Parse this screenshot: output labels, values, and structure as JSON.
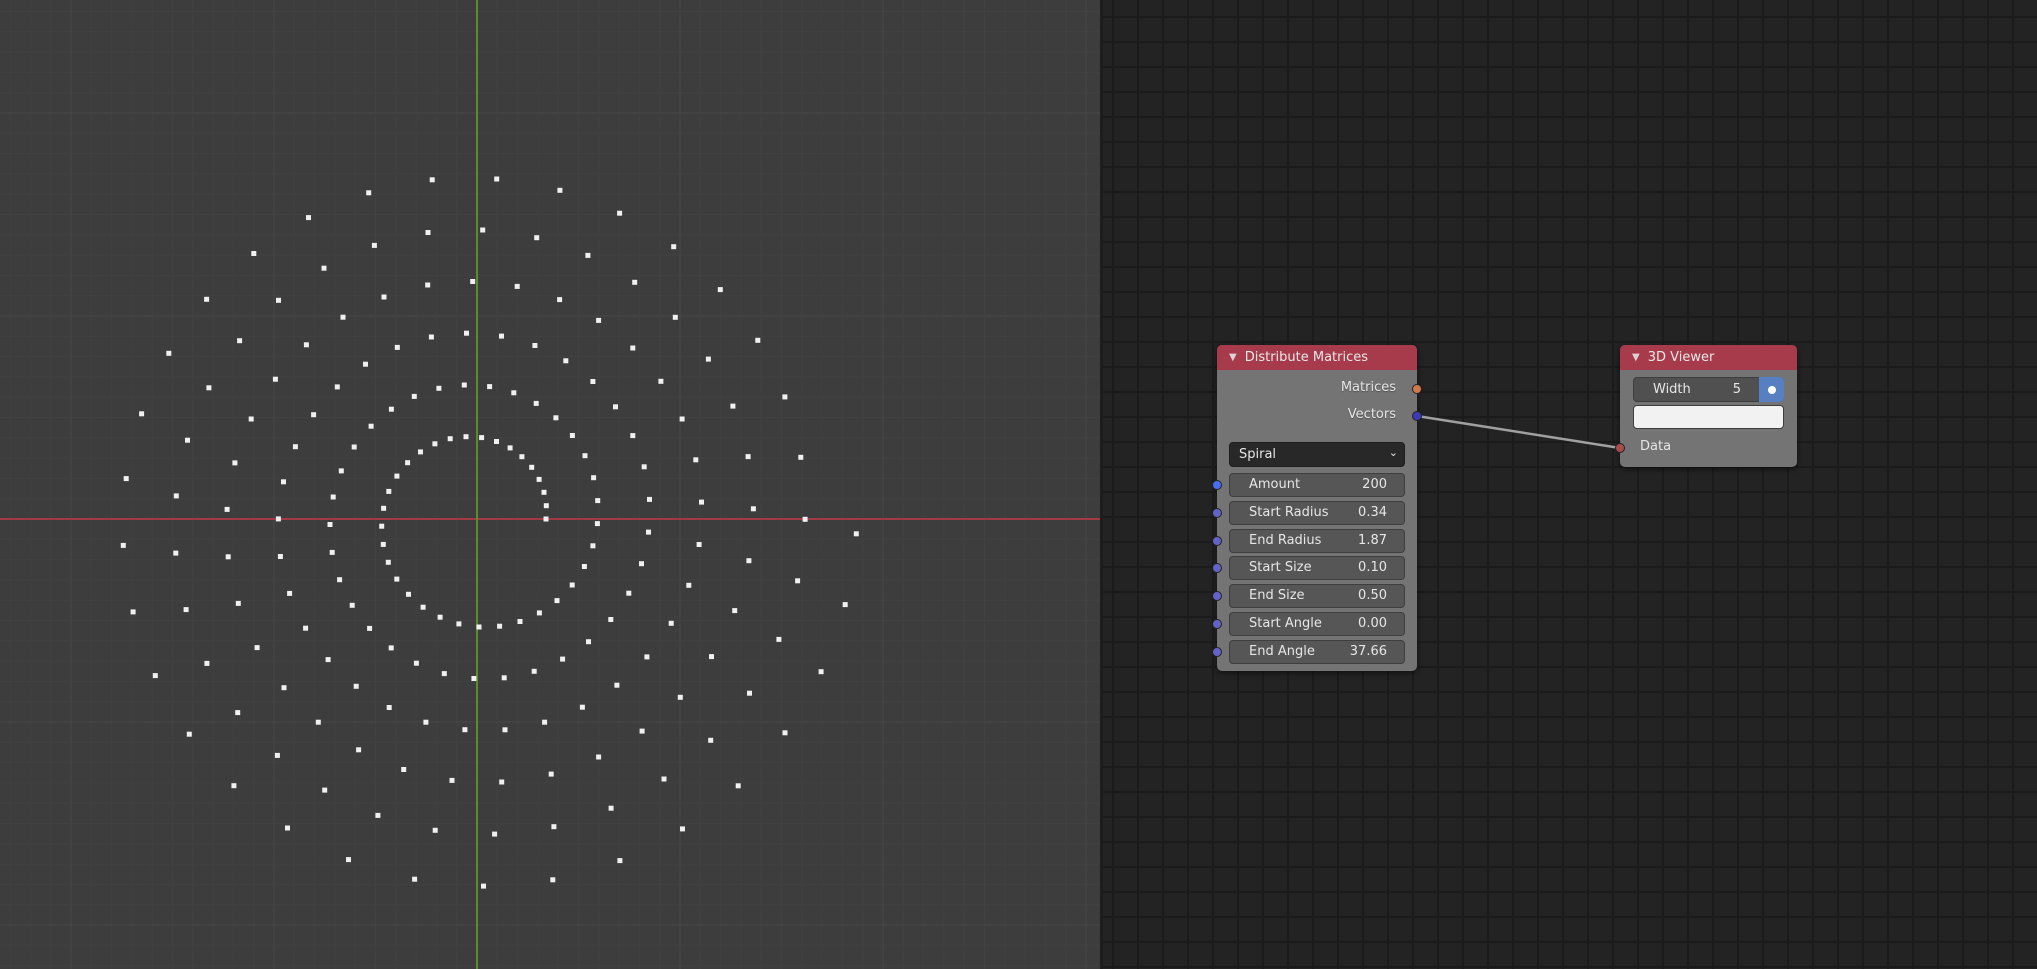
{
  "viewport": {
    "axes": {
      "x_color": "#a23a45",
      "y_color": "#5e8c2a"
    },
    "point_color": "#f0f0f0",
    "spiral": {
      "amount": 200,
      "start_radius": 0.34,
      "end_radius": 1.87,
      "start_angle": 0.0,
      "end_angle": 37.66
    }
  },
  "nodes": {
    "distribute": {
      "title": "Distribute Matrices",
      "header_color": "#a83b4b",
      "outputs": [
        {
          "label": "Matrices",
          "color": "#d07a4c"
        },
        {
          "label": "Vectors",
          "color": "#3b3bb8"
        }
      ],
      "mode": "Spiral",
      "fields": [
        {
          "label": "Amount",
          "value": "200",
          "socket_color": "#4a6cf0"
        },
        {
          "label": "Start Radius",
          "value": "0.34",
          "socket_color": "#6363c7"
        },
        {
          "label": "End Radius",
          "value": "1.87",
          "socket_color": "#6363c7"
        },
        {
          "label": "Start Size",
          "value": "0.10",
          "socket_color": "#6363c7"
        },
        {
          "label": "End Size",
          "value": "0.50",
          "socket_color": "#6363c7"
        },
        {
          "label": "Start Angle",
          "value": "0.00",
          "socket_color": "#6363c7"
        },
        {
          "label": "End Angle",
          "value": "37.66",
          "socket_color": "#6363c7"
        }
      ]
    },
    "viewer": {
      "title": "3D Viewer",
      "header_color": "#a83b4b",
      "width_label": "Width",
      "width_value": "5",
      "toggle_color": "#5680c2",
      "color_swatch": "#f2f2f2",
      "input": {
        "label": "Data",
        "color": "#a84b4b"
      }
    }
  },
  "links": [
    {
      "from": "distribute.Vectors",
      "to": "viewer.Data",
      "color": "#a0a0a0"
    }
  ]
}
